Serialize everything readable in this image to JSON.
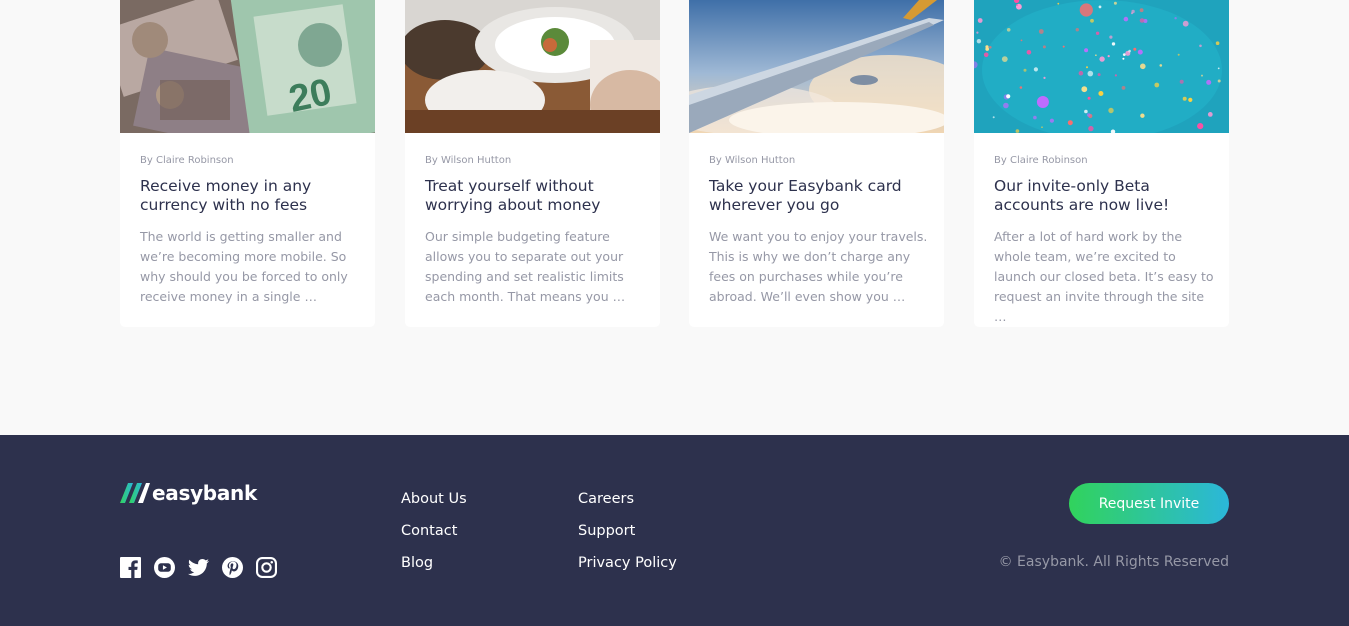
{
  "articles": [
    {
      "author": "By Claire Robinson",
      "title": "Receive money in any currency with no fees",
      "excerpt": "The world is getting smaller and we’re becoming more mobile. So why should you be forced to only receive money in a single …",
      "image_icon": "currency-photo"
    },
    {
      "author": "By Wilson Hutton",
      "title": "Treat yourself without worrying about money",
      "excerpt": "Our simple budgeting feature allows you to separate out your spending and set realistic limits each month. That means you …",
      "image_icon": "restaurant-photo"
    },
    {
      "author": "By Wilson Hutton",
      "title": "Take your Easybank card wherever you go",
      "excerpt": "We want you to enjoy your travels. This is why we don’t charge any fees on purchases while you’re abroad. We’ll even show you …",
      "image_icon": "airplane-photo"
    },
    {
      "author": "By Claire Robinson",
      "title": "Our invite-only Beta accounts are now live!",
      "excerpt": "After a lot of hard work by the whole team, we’re excited to launch our closed beta. It’s easy to request an invite through the site …",
      "image_icon": "confetti-photo"
    }
  ],
  "footer": {
    "logo_text": "easybank",
    "social_icons": [
      "facebook-icon",
      "youtube-icon",
      "twitter-icon",
      "pinterest-icon",
      "instagram-icon"
    ],
    "links_col1": [
      "About Us",
      "Contact",
      "Blog"
    ],
    "links_col2": [
      "Careers",
      "Support",
      "Privacy Policy"
    ],
    "cta_label": "Request Invite",
    "copyright": "© Easybank. All Rights Reserved"
  },
  "colors": {
    "dark_blue": "#2d314d",
    "lime_green": "#31d35c",
    "bright_cyan": "#2bb7da",
    "grayish_blue": "#9698a6",
    "light_gray": "#f9f9f9"
  }
}
